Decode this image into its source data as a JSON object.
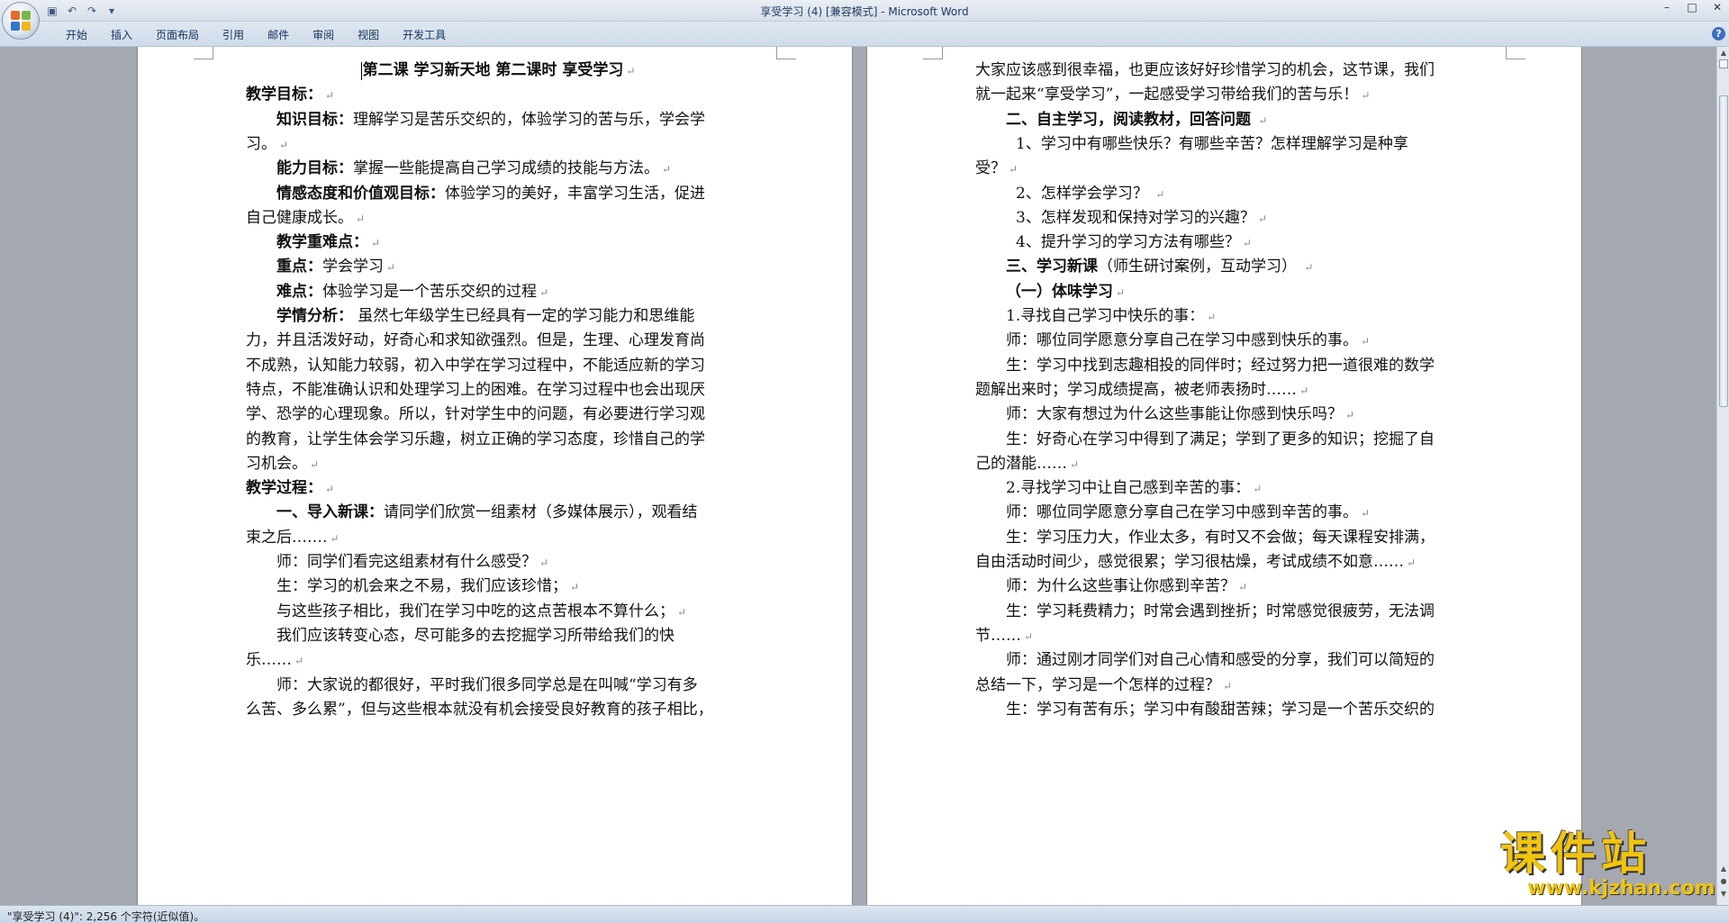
{
  "window": {
    "title": "享受学习 (4) [兼容模式] - Microsoft Word",
    "controls": [
      "minimize-icon",
      "maximize-icon",
      "close-icon"
    ]
  },
  "quick_access": {
    "icons": [
      "save-icon",
      "undo-icon",
      "redo-icon",
      "customize-icon"
    ],
    "glyphs": [
      "▣",
      "↶",
      "↷",
      "▾"
    ]
  },
  "ribbon": {
    "tabs": [
      "开始",
      "插入",
      "页面布局",
      "引用",
      "邮件",
      "审阅",
      "视图",
      "开发工具"
    ],
    "help_label": "?"
  },
  "document": {
    "left_page": [
      {
        "style": "title",
        "runs": [
          {
            "t": "第二课  学习新天地  第二课时  享受学习",
            "b": true
          }
        ]
      },
      {
        "style": "flush",
        "runs": [
          {
            "t": "教学目标：",
            "b": true
          }
        ]
      },
      {
        "style": "indent",
        "runs": [
          {
            "t": "知识目标：",
            "b": true
          },
          {
            "t": "理解学习是苦乐交织的，体验学习的苦与乐，学会学"
          }
        ],
        "nomark": true
      },
      {
        "style": "flush",
        "runs": [
          {
            "t": "习。"
          }
        ]
      },
      {
        "style": "indent",
        "runs": [
          {
            "t": "能力目标：",
            "b": true
          },
          {
            "t": "掌握一些能提高自己学习成绩的技能与方法。"
          }
        ]
      },
      {
        "style": "indent",
        "runs": [
          {
            "t": "情感态度和价值观目标：",
            "b": true
          },
          {
            "t": "体验学习的美好，丰富学习生活，促进"
          }
        ],
        "nomark": true
      },
      {
        "style": "flush",
        "runs": [
          {
            "t": "自己健康成长。"
          }
        ]
      },
      {
        "style": "indent",
        "runs": [
          {
            "t": "教学重难点：",
            "b": true
          }
        ]
      },
      {
        "style": "indent",
        "runs": [
          {
            "t": "重点：",
            "b": true
          },
          {
            "t": "学会学习"
          }
        ]
      },
      {
        "style": "indent",
        "runs": [
          {
            "t": "难点：",
            "b": true
          },
          {
            "t": "体验学习是一个苦乐交织的过程"
          }
        ]
      },
      {
        "style": "indent",
        "runs": [
          {
            "t": "学情分析：",
            "b": true
          },
          {
            "t": " 虽然七年级学生已经具有一定的学习能力和思维能"
          }
        ],
        "nomark": true
      },
      {
        "style": "flush",
        "runs": [
          {
            "t": "力，并且活泼好动，好奇心和求知欲强烈。但是，生理、心理发育尚"
          }
        ],
        "nomark": true
      },
      {
        "style": "flush",
        "runs": [
          {
            "t": "不成熟，认知能力较弱，初入中学在学习过程中，不能适应新的学习"
          }
        ],
        "nomark": true
      },
      {
        "style": "flush",
        "runs": [
          {
            "t": "特点，不能准确认识和处理学习上的困难。在学习过程中也会出现厌"
          }
        ],
        "nomark": true
      },
      {
        "style": "flush",
        "runs": [
          {
            "t": "学、恐学的心理现象。所以，针对学生中的问题，有必要进行学习观"
          }
        ],
        "nomark": true
      },
      {
        "style": "flush",
        "runs": [
          {
            "t": "的教育，让学生体会学习乐趣，树立正确的学习态度，珍惜自己的学"
          }
        ],
        "nomark": true
      },
      {
        "style": "flush",
        "runs": [
          {
            "t": "习机会。"
          }
        ]
      },
      {
        "style": "flush",
        "runs": [
          {
            "t": "教学过程：",
            "b": true
          }
        ]
      },
      {
        "style": "indent",
        "runs": [
          {
            "t": "一、导入新课：",
            "b": true
          },
          {
            "t": "请同学们欣赏一组素材（多媒体展示），观看结"
          }
        ],
        "nomark": true
      },
      {
        "style": "flush",
        "runs": [
          {
            "t": "束之后……."
          }
        ]
      },
      {
        "style": "indent",
        "runs": [
          {
            "t": "师：同学们看完这组素材有什么感受？"
          }
        ]
      },
      {
        "style": "indent",
        "runs": [
          {
            "t": "生：学习的机会来之不易，我们应该珍惜；"
          }
        ]
      },
      {
        "style": "indent",
        "runs": [
          {
            "t": "与这些孩子相比，我们在学习中吃的这点苦根本不算什么；"
          }
        ]
      },
      {
        "style": "indent",
        "runs": [
          {
            "t": "我们应该转变心态，尽可能多的去挖掘学习所带给我们的快"
          }
        ],
        "nomark": true
      },
      {
        "style": "flush",
        "runs": [
          {
            "t": "乐……"
          }
        ]
      },
      {
        "style": "indent",
        "runs": [
          {
            "t": "师：大家说的都很好，平时我们很多同学总是在叫喊“学习有多"
          }
        ],
        "nomark": true
      },
      {
        "style": "flush",
        "runs": [
          {
            "t": "么苦、多么累”，但与这些根本就没有机会接受良好教育的孩子相比，"
          }
        ],
        "nomark": true
      }
    ],
    "right_page": [
      {
        "style": "flush",
        "runs": [
          {
            "t": "大家应该感到很幸福，也更应该好好珍惜学习的机会，这节课，我们"
          }
        ],
        "nomark": true
      },
      {
        "style": "flush",
        "runs": [
          {
            "t": "就一起来“享受学习”，一起感受学习带给我们的苦与乐！"
          }
        ]
      },
      {
        "style": "indent",
        "runs": [
          {
            "t": "二、自主学习，阅读教材，回答问题",
            "b": true
          },
          {
            "t": "  "
          }
        ]
      },
      {
        "style": "indent2",
        "runs": [
          {
            "t": "1、学习中有哪些快乐？有哪些辛苦？怎样理解学习是种享"
          }
        ],
        "nomark": true
      },
      {
        "style": "flush",
        "runs": [
          {
            "t": "受？"
          }
        ]
      },
      {
        "style": "indent2",
        "runs": [
          {
            "t": "2、怎样学会学习？  "
          }
        ]
      },
      {
        "style": "indent2",
        "runs": [
          {
            "t": "3、怎样发现和保持对学习的兴趣？"
          }
        ]
      },
      {
        "style": "indent2",
        "runs": [
          {
            "t": "4、提升学习的学习方法有哪些？"
          }
        ]
      },
      {
        "style": "indent",
        "runs": [
          {
            "t": "三、学习新课",
            "b": true
          },
          {
            "t": "（师生研讨案例，互动学习）  "
          }
        ]
      },
      {
        "style": "indent",
        "runs": [
          {
            "t": "（一）体味学习",
            "b": true
          }
        ]
      },
      {
        "style": "indent",
        "runs": [
          {
            "t": "1.寻找自己学习中快乐的事："
          }
        ]
      },
      {
        "style": "indent",
        "runs": [
          {
            "t": "师：哪位同学愿意分享自己在学习中感到快乐的事。"
          }
        ]
      },
      {
        "style": "indent",
        "runs": [
          {
            "t": "生：学习中找到志趣相投的同伴时；经过努力把一道很难的数学"
          }
        ],
        "nomark": true
      },
      {
        "style": "flush",
        "runs": [
          {
            "t": "题解出来时；学习成绩提高，被老师表扬时……"
          }
        ]
      },
      {
        "style": "indent",
        "runs": [
          {
            "t": "师：大家有想过为什么这些事能让你感到快乐吗？"
          }
        ]
      },
      {
        "style": "indent",
        "runs": [
          {
            "t": "生：好奇心在学习中得到了满足；学到了更多的知识；挖掘了自"
          }
        ],
        "nomark": true
      },
      {
        "style": "flush",
        "runs": [
          {
            "t": "己的潜能……"
          }
        ]
      },
      {
        "style": "indent",
        "runs": [
          {
            "t": "2.寻找学习中让自己感到辛苦的事："
          }
        ]
      },
      {
        "style": "indent",
        "runs": [
          {
            "t": "师：哪位同学愿意分享自己在学习中感到辛苦的事。"
          }
        ]
      },
      {
        "style": "indent",
        "runs": [
          {
            "t": "生：学习压力大，作业太多，有时又不会做；每天课程安排满，"
          }
        ],
        "nomark": true
      },
      {
        "style": "flush",
        "runs": [
          {
            "t": "自由活动时间少，感觉很累；学习很枯燥，考试成绩不如意……"
          }
        ]
      },
      {
        "style": "indent",
        "runs": [
          {
            "t": "师：为什么这些事让你感到辛苦？"
          }
        ]
      },
      {
        "style": "indent",
        "runs": [
          {
            "t": "生：学习耗费精力；时常会遇到挫折；时常感觉很疲劳，无法调"
          }
        ],
        "nomark": true
      },
      {
        "style": "flush",
        "runs": [
          {
            "t": "节……"
          }
        ]
      },
      {
        "style": "indent",
        "runs": [
          {
            "t": "师：通过刚才同学们对自己心情和感受的分享，我们可以简短的"
          }
        ],
        "nomark": true
      },
      {
        "style": "flush",
        "runs": [
          {
            "t": "总结一下，学习是一个怎样的过程？"
          }
        ]
      },
      {
        "style": "indent",
        "runs": [
          {
            "t": "生：学习有苦有乐；学习中有酸甜苦辣；学习是一个苦乐交织的"
          }
        ],
        "nomark": true
      }
    ],
    "paragraph_mark": "↵"
  },
  "status_bar": {
    "text": "\"享受学习 (4)\": 2,256 个字符(近似值)。"
  },
  "watermark": {
    "title": "课件站",
    "url": "www.kjzhan.com"
  }
}
